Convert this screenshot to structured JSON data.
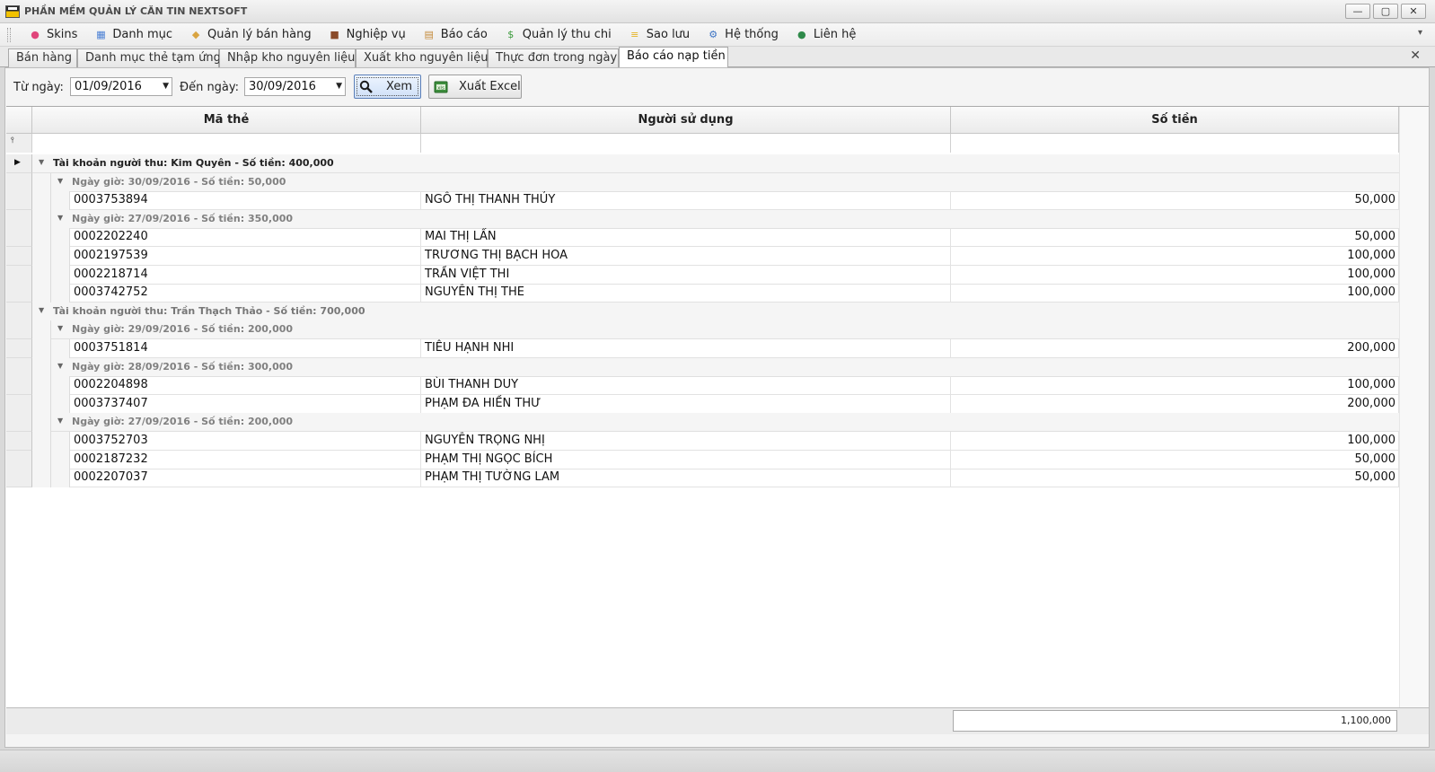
{
  "window": {
    "title": "PHẦN MỀM QUẢN LÝ CĂN TIN NEXTSOFT",
    "buttons": [
      "—",
      "▢",
      "✕"
    ]
  },
  "menu": [
    {
      "label": "Skins",
      "icon": "palette-icon",
      "color": "#e0457b"
    },
    {
      "label": "Danh mục",
      "icon": "grid-icon",
      "color": "#4a7fd4"
    },
    {
      "label": "Quản lý bán hàng",
      "icon": "tag-icon",
      "color": "#d9a441"
    },
    {
      "label": "Nghiệp vụ",
      "icon": "briefcase-icon",
      "color": "#8a4b2a"
    },
    {
      "label": "Báo cáo",
      "icon": "clipboard-icon",
      "color": "#c48a3a"
    },
    {
      "label": "Quản lý thu chi",
      "icon": "money-icon",
      "color": "#3a9a3a"
    },
    {
      "label": "Sao lưu",
      "icon": "database-icon",
      "color": "#e6b325"
    },
    {
      "label": "Hệ thống",
      "icon": "gears-icon",
      "color": "#3d74c4"
    },
    {
      "label": "Liên hệ",
      "icon": "user-icon",
      "color": "#2f8a4a"
    }
  ],
  "tabs": [
    {
      "label": "Bán hàng"
    },
    {
      "label": "Danh mục thẻ tạm ứng"
    },
    {
      "label": "Nhập kho nguyên liệu"
    },
    {
      "label": "Xuất kho nguyên liệu"
    },
    {
      "label": "Thực đơn trong ngày"
    },
    {
      "label": "Báo cáo nạp tiền",
      "active": true
    }
  ],
  "filters": {
    "from_label": "Từ ngày:",
    "from_value": "01/09/2016",
    "to_label": "Đến ngày:",
    "to_value": "30/09/2016",
    "view_button": "Xem",
    "export_button": "Xuất Excel"
  },
  "grid": {
    "columns": [
      "Mã thẻ",
      "Người sử dụng",
      "Số tiền"
    ],
    "groups": [
      {
        "label": "Tài khoản người thu: Kim Quyên  - Số tiền: 400,000",
        "subgroups": [
          {
            "label": "Ngày giờ: 30/09/2016  - Số tiền: 50,000",
            "rows": [
              [
                "0003753894",
                "NGÔ THỊ THANH THỦY",
                "50,000"
              ]
            ]
          },
          {
            "label": "Ngày giờ: 27/09/2016  - Số tiền: 350,000",
            "rows": [
              [
                "0002202240",
                "MAI THỊ LẤN",
                "50,000"
              ],
              [
                "0002197539",
                "TRƯƠNG THỊ BẠCH HOA",
                "100,000"
              ],
              [
                "0002218714",
                "TRẦN VIỆT THI",
                "100,000"
              ],
              [
                "0003742752",
                "NGUYỄN THỊ THE",
                "100,000"
              ]
            ]
          }
        ]
      },
      {
        "label": "Tài khoản người thu: Trần Thạch Thảo  - Số tiền: 700,000",
        "subgroups": [
          {
            "label": "Ngày giờ: 29/09/2016  - Số tiền: 200,000",
            "rows": [
              [
                "0003751814",
                "TIÊU HẠNH NHI",
                "200,000"
              ]
            ]
          },
          {
            "label": "Ngày giờ: 28/09/2016  - Số tiền: 300,000",
            "rows": [
              [
                "0002204898",
                "BÙI THANH DUY",
                "100,000"
              ],
              [
                "0003737407",
                "PHẠM ĐA HIỀN THƯ",
                "200,000"
              ]
            ]
          },
          {
            "label": "Ngày giờ: 27/09/2016  - Số tiền: 200,000",
            "rows": [
              [
                "0003752703",
                "NGUYỄN TRỌNG NHỊ",
                "100,000"
              ],
              [
                "0002187232",
                "PHẠM THỊ NGỌC BÍCH",
                "50,000"
              ],
              [
                "0002207037",
                "PHẠM THỊ TƯỜNG LAM",
                "50,000"
              ]
            ]
          }
        ]
      }
    ],
    "total": "1,100,000"
  }
}
